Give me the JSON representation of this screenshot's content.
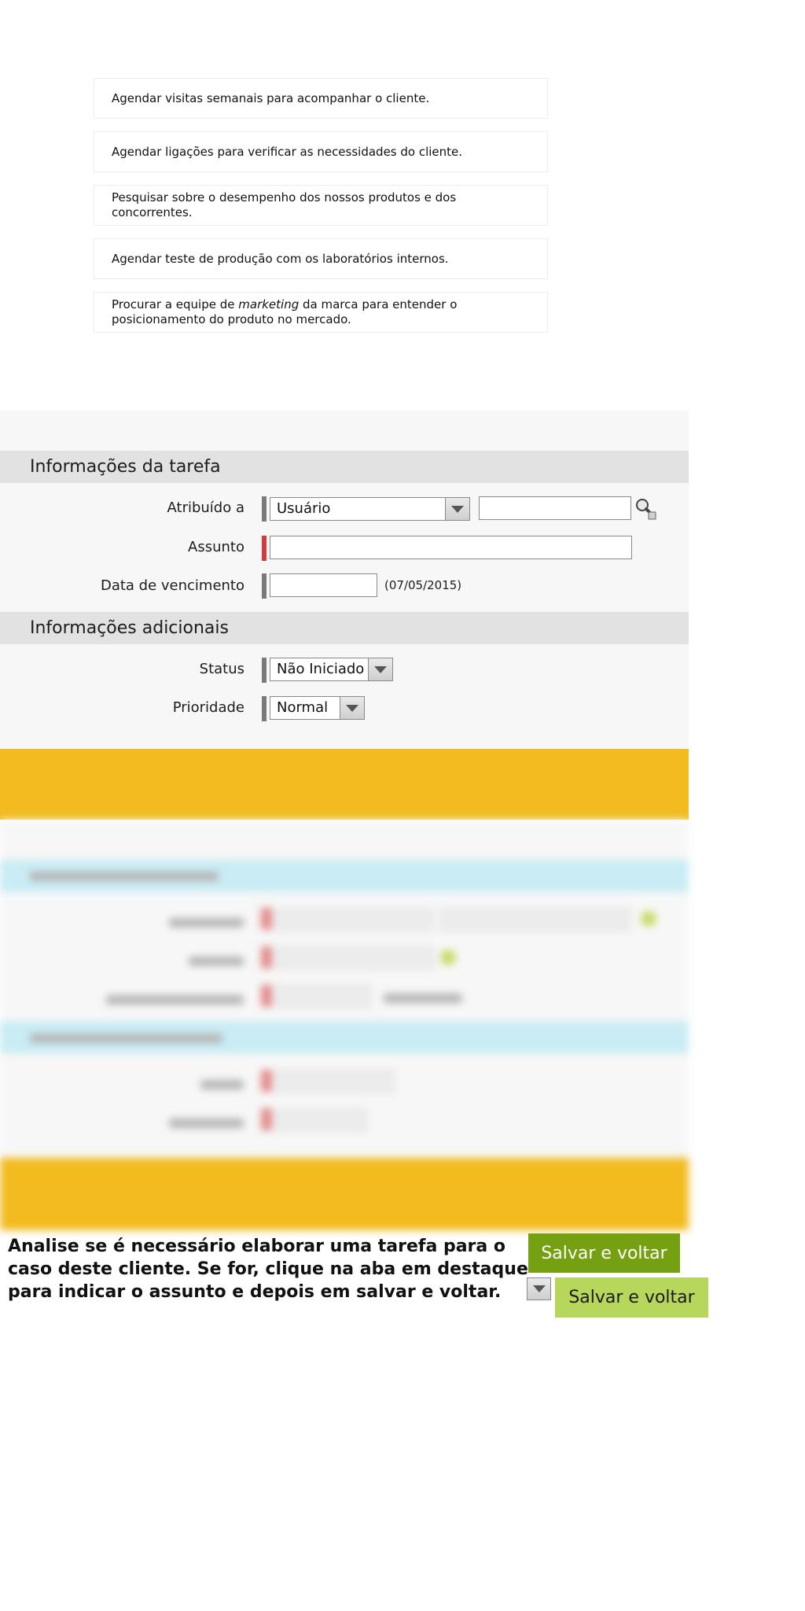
{
  "options": [
    {
      "text": "Agendar visitas semanais para acompanhar o cliente."
    },
    {
      "text": "Agendar ligações para verificar as necessidades do cliente."
    },
    {
      "text": "Pesquisar sobre o desempenho dos nossos produtos e dos concorrentes."
    },
    {
      "text": "Agendar teste de produção com os laboratórios internos."
    },
    {
      "text_before": "Procurar a equipe de ",
      "text_em": "marketing",
      "text_after": " da marca para entender o posicionamento do produto no mercado."
    }
  ],
  "task_form": {
    "section_task": "Informações da tarefa",
    "assigned_label": "Atribuído a",
    "assigned_type": "Usuário",
    "assigned_value": "",
    "subject_label": "Assunto",
    "subject_value": "",
    "due_label": "Data de vencimento",
    "due_value": "",
    "due_hint": "(07/05/2015)",
    "section_additional": "Informações adicionais",
    "status_label": "Status",
    "status_value": "Não Iniciado",
    "priority_label": "Prioridade",
    "priority_value": "Normal"
  },
  "instruction": "Analise se é necessário elaborar uma tarefa para o caso deste cliente. Se for, clique na aba em destaque para indicar o assunto e depois em salvar e voltar.",
  "buttons": {
    "save_primary": "Salvar e voltar",
    "save_secondary": "Salvar e voltar"
  },
  "colors": {
    "accent_yellow": "#f2bb1f",
    "button_dark_green": "#74a012",
    "button_light_green": "#b7d65c",
    "required_red": "#d53a3a"
  }
}
